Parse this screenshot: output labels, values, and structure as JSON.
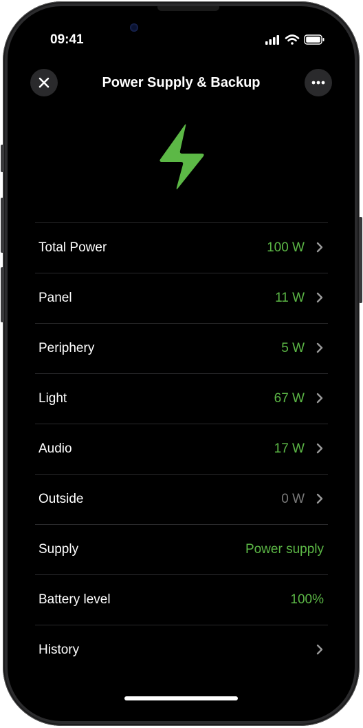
{
  "status_bar": {
    "time": "09:41"
  },
  "nav": {
    "title": "Power Supply & Backup",
    "close_icon": "close-icon",
    "more_icon": "more-icon"
  },
  "hero_icon": "lightning-bolt-icon",
  "colors": {
    "accent_green": "#5cb846",
    "muted_grey": "#7a7a7a",
    "background": "#000000"
  },
  "rows": [
    {
      "label": "Total Power",
      "value": "100 W",
      "value_color": "green",
      "chevron": true
    },
    {
      "label": "Panel",
      "value": "11 W",
      "value_color": "green",
      "chevron": true
    },
    {
      "label": "Periphery",
      "value": "5 W",
      "value_color": "green",
      "chevron": true
    },
    {
      "label": "Light",
      "value": "67 W",
      "value_color": "green",
      "chevron": true
    },
    {
      "label": "Audio",
      "value": "17 W",
      "value_color": "green",
      "chevron": true
    },
    {
      "label": "Outside",
      "value": "0 W",
      "value_color": "grey",
      "chevron": true
    },
    {
      "label": "Supply",
      "value": "Power supply",
      "value_color": "green",
      "chevron": false
    },
    {
      "label": "Battery level",
      "value": "100%",
      "value_color": "green",
      "chevron": false
    },
    {
      "label": "History",
      "value": "",
      "value_color": "green",
      "chevron": true
    }
  ]
}
